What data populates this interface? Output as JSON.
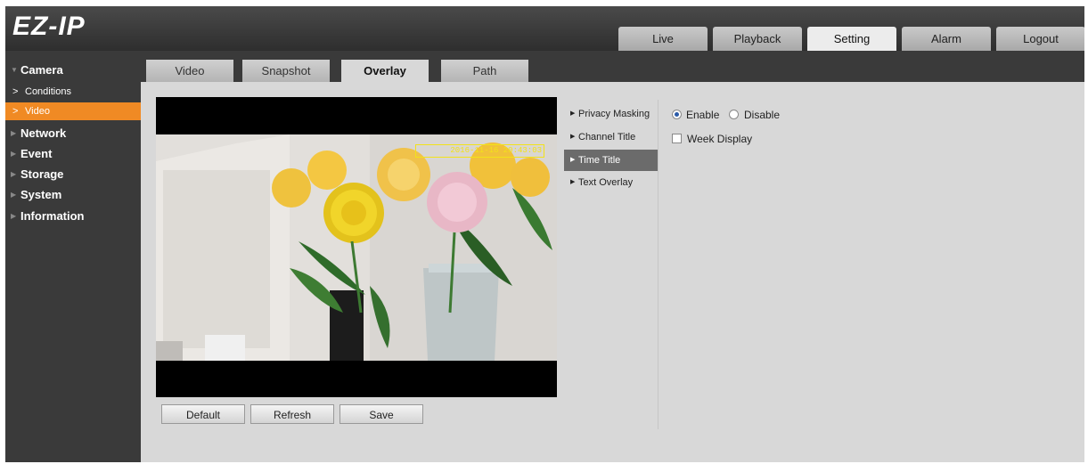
{
  "header": {
    "logo": "EZ-IP",
    "nav": [
      "Live",
      "Playback",
      "Setting",
      "Alarm",
      "Logout"
    ],
    "active_nav": "Setting"
  },
  "sidebar": {
    "camera": "Camera",
    "camera_sub": [
      "Conditions",
      "Video"
    ],
    "items": [
      "Network",
      "Event",
      "Storage",
      "System",
      "Information"
    ]
  },
  "subtabs": [
    "Video",
    "Snapshot",
    "Overlay",
    "Path"
  ],
  "active_subtab": "Overlay",
  "video": {
    "timestamp": "2016-11-16 20:43:03"
  },
  "buttons": {
    "default": "Default",
    "refresh": "Refresh",
    "save": "Save"
  },
  "overlay_menu": [
    "Privacy Masking",
    "Channel Title",
    "Time Title",
    "Text Overlay"
  ],
  "active_overlay": "Time Title",
  "settings": {
    "enable": "Enable",
    "disable": "Disable",
    "enabled": true,
    "week_display": "Week Display",
    "week_display_checked": false
  },
  "colors": {
    "accent_orange": "#f08a24",
    "highlight_yellow": "#f2e21a",
    "menu_active": "#6b6b6b"
  }
}
